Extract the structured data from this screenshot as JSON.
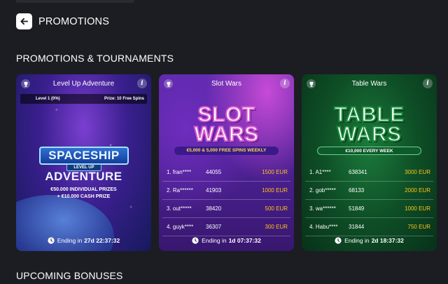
{
  "header": {
    "title": "PROMOTIONS"
  },
  "sections": {
    "promotions_title": "PROMOTIONS & TOURNAMENTS",
    "upcoming_title": "UPCOMING BONUSES"
  },
  "cards": [
    {
      "title": "Level Up Adventure",
      "level_label": "Level 1 (0%)",
      "level_progress": 0,
      "prize_label": "Prize: 10 Free Spins",
      "logo_line1": "SPACESHIP",
      "logo_line2": "LEVEL UP",
      "logo_line3": "ADVENTURE",
      "desc_line1": "€50.000 INDIVIDUAL PRIZES",
      "desc_line2": "+ €10.000 CASH PRIZE",
      "ending_label": "Ending in",
      "ending_value": "27d 22:37:32"
    },
    {
      "title": "Slot Wars",
      "logo_line1": "SLOT",
      "logo_line2": "WARS",
      "banner": "€5,000 & 5,000 FREE SPINS WEEKLY",
      "leaderboard": [
        {
          "rank": "1. fran****",
          "score": "44055",
          "prize": "1500 EUR"
        },
        {
          "rank": "2. Ra******",
          "score": "41903",
          "prize": "1000 EUR"
        },
        {
          "rank": "3. out*****",
          "score": "38420",
          "prize": "500 EUR"
        },
        {
          "rank": "4. guyk****",
          "score": "36307",
          "prize": "300 EUR"
        }
      ],
      "ending_label": "Ending in",
      "ending_value": "1d 07:37:32"
    },
    {
      "title": "Table Wars",
      "logo_line1": "TABLE",
      "logo_line2": "WARS",
      "banner": "€10,000 EVERY WEEK",
      "leaderboard": [
        {
          "rank": "1. A1****",
          "score": "638341",
          "prize": "3000 EUR"
        },
        {
          "rank": "2. gob*****",
          "score": "68133",
          "prize": "2000 EUR"
        },
        {
          "rank": "3. wa******",
          "score": "51849",
          "prize": "1000 EUR"
        },
        {
          "rank": "4. Habu****",
          "score": "31844",
          "prize": "750 EUR"
        }
      ],
      "ending_label": "Ending in",
      "ending_value": "2d 18:37:32"
    }
  ],
  "colors": {
    "background": "#1c1d22",
    "prize": "#ffc21a"
  },
  "icons": {
    "back": "arrow-left-icon",
    "trophy": "trophy-icon",
    "info": "info-icon",
    "clock": "clock-icon"
  }
}
